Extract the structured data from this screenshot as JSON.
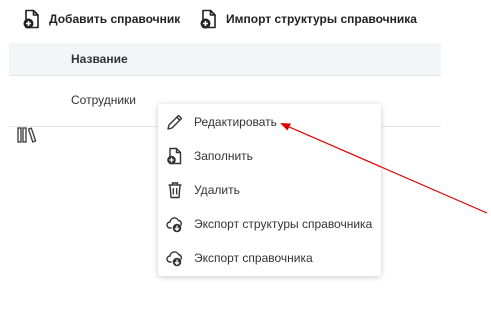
{
  "toolbar": {
    "add_label": "Добавить справочник",
    "import_label": "Импорт структуры справочника"
  },
  "table": {
    "columns": [
      "Название"
    ],
    "rows": [
      {
        "name": "Сотрудники",
        "icon": "books-icon"
      }
    ]
  },
  "context_menu": {
    "items": [
      {
        "label": "Редактировать",
        "icon": "pencil-icon"
      },
      {
        "label": "Заполнить",
        "icon": "file-add-icon"
      },
      {
        "label": "Удалить",
        "icon": "trash-icon"
      },
      {
        "label": "Экспорт структуры справочника",
        "icon": "cloud-download-icon"
      },
      {
        "label": "Экспорт справочника",
        "icon": "cloud-download-icon"
      }
    ]
  },
  "colors": {
    "annotation_arrow": "#e00000",
    "header_bg": "#f4f5f7",
    "border": "#e3e5e8"
  }
}
